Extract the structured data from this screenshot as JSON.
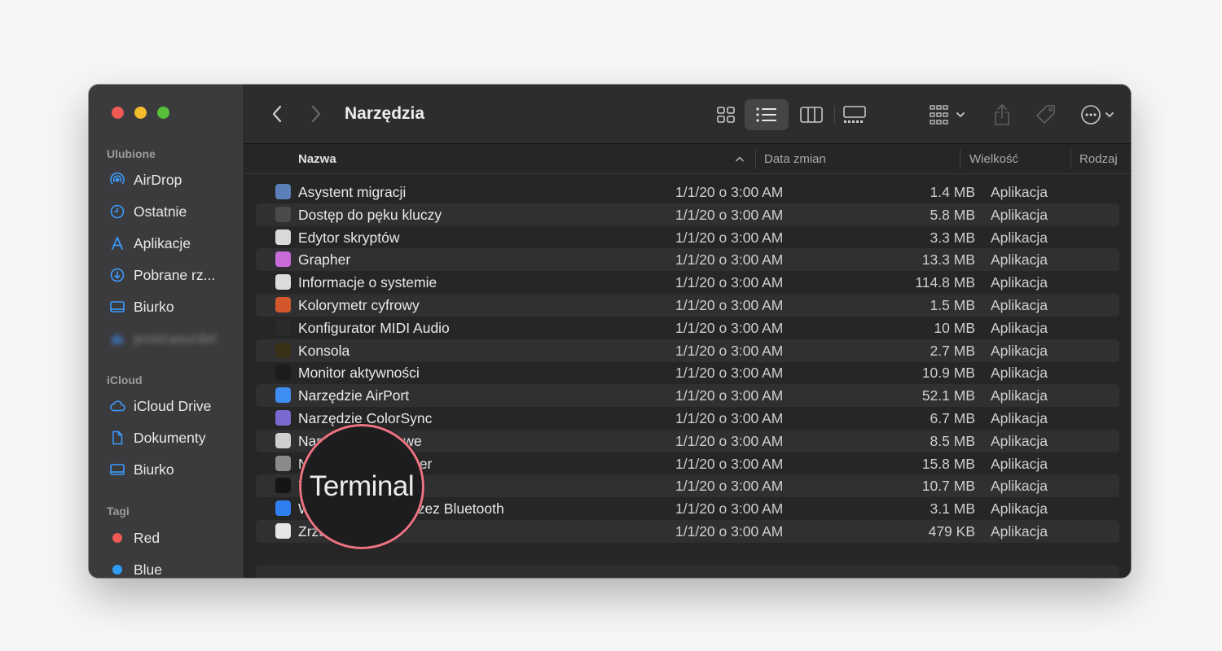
{
  "sidebar": {
    "favorites_title": "Ulubione",
    "favorites": [
      {
        "label": "AirDrop",
        "icon": "airdrop-icon"
      },
      {
        "label": "Ostatnie",
        "icon": "clock-icon"
      },
      {
        "label": "Aplikacje",
        "icon": "applications-icon"
      },
      {
        "label": "Pobrane rz...",
        "icon": "download-icon"
      },
      {
        "label": "Biurko",
        "icon": "desktop-icon"
      },
      {
        "label": "jessicasurdel",
        "icon": "home-icon"
      }
    ],
    "icloud_title": "iCloud",
    "icloud": [
      {
        "label": "iCloud Drive",
        "icon": "cloud-icon"
      },
      {
        "label": "Dokumenty",
        "icon": "document-icon"
      },
      {
        "label": "Biurko",
        "icon": "desktop-icon"
      }
    ],
    "tags_title": "Tagi",
    "tags": [
      {
        "label": "Red",
        "color": "#ee5b55"
      },
      {
        "label": "Blue",
        "color": "#2f9cf4"
      }
    ]
  },
  "toolbar": {
    "title": "Narzędzia"
  },
  "columns": {
    "name": "Nazwa",
    "date": "Data zmian",
    "size": "Wielkość",
    "kind": "Rodzaj"
  },
  "files": [
    {
      "name": "Asystent migracji",
      "date": "1/1/20 o 3:00 AM",
      "size": "1.4 MB",
      "kind": "Aplikacja",
      "icon": "migration-assistant-icon",
      "color": "#5b7fb8"
    },
    {
      "name": "Dostęp do pęku kluczy",
      "date": "1/1/20 o 3:00 AM",
      "size": "5.8 MB",
      "kind": "Aplikacja",
      "icon": "keychain-icon",
      "color": "#4a4a4a"
    },
    {
      "name": "Edytor skryptów",
      "date": "1/1/20 o 3:00 AM",
      "size": "3.3 MB",
      "kind": "Aplikacja",
      "icon": "script-editor-icon",
      "color": "#d9d9d9"
    },
    {
      "name": "Grapher",
      "date": "1/1/20 o 3:00 AM",
      "size": "13.3 MB",
      "kind": "Aplikacja",
      "icon": "grapher-icon",
      "color": "#c86ad8"
    },
    {
      "name": "Informacje o systemie",
      "date": "1/1/20 o 3:00 AM",
      "size": "114.8 MB",
      "kind": "Aplikacja",
      "icon": "system-info-icon",
      "color": "#dcdcdc"
    },
    {
      "name": "Kolorymetr cyfrowy",
      "date": "1/1/20 o 3:00 AM",
      "size": "1.5 MB",
      "kind": "Aplikacja",
      "icon": "color-meter-icon",
      "color": "#d2572b"
    },
    {
      "name": "Konfigurator MIDI Audio",
      "date": "1/1/20 o 3:00 AM",
      "size": "10 MB",
      "kind": "Aplikacja",
      "icon": "midi-icon",
      "color": "#2b2b2b"
    },
    {
      "name": "Konsola",
      "date": "1/1/20 o 3:00 AM",
      "size": "2.7 MB",
      "kind": "Aplikacja",
      "icon": "console-icon",
      "color": "#3a3218"
    },
    {
      "name": "Monitor aktywności",
      "date": "1/1/20 o 3:00 AM",
      "size": "10.9 MB",
      "kind": "Aplikacja",
      "icon": "activity-monitor-icon",
      "color": "#1c1c1c"
    },
    {
      "name": "Narzędzie AirPort",
      "date": "1/1/20 o 3:00 AM",
      "size": "52.1 MB",
      "kind": "Aplikacja",
      "icon": "airport-icon",
      "color": "#3e8df0"
    },
    {
      "name": "Narzędzie ColorSync",
      "date": "1/1/20 o 3:00 AM",
      "size": "6.7 MB",
      "kind": "Aplikacja",
      "icon": "colorsync-icon",
      "color": "#7a6ad0"
    },
    {
      "name": "Narzędzie dyskowe",
      "date": "1/1/20 o 3:00 AM",
      "size": "8.5 MB",
      "kind": "Aplikacja",
      "icon": "disk-utility-icon",
      "color": "#cfcfcf"
    },
    {
      "name": "Narzędzie VoiceOver",
      "date": "1/1/20 o 3:00 AM",
      "size": "15.8 MB",
      "kind": "Aplikacja",
      "icon": "voiceover-icon",
      "color": "#8a8a8a"
    },
    {
      "name": "Terminal",
      "date": "1/1/20 o 3:00 AM",
      "size": "10.7 MB",
      "kind": "Aplikacja",
      "icon": "terminal-icon",
      "color": "#151515"
    },
    {
      "name": "Wymiana plików przez Bluetooth",
      "date": "1/1/20 o 3:00 AM",
      "size": "3.1 MB",
      "kind": "Aplikacja",
      "icon": "bluetooth-icon",
      "color": "#2f7ff0"
    },
    {
      "name": "Zrzut ekranu",
      "date": "1/1/20 o 3:00 AM",
      "size": "479 KB",
      "kind": "Aplikacja",
      "icon": "screenshot-icon",
      "color": "#e6e6e6"
    }
  ],
  "magnifier": {
    "label": "Terminal"
  }
}
